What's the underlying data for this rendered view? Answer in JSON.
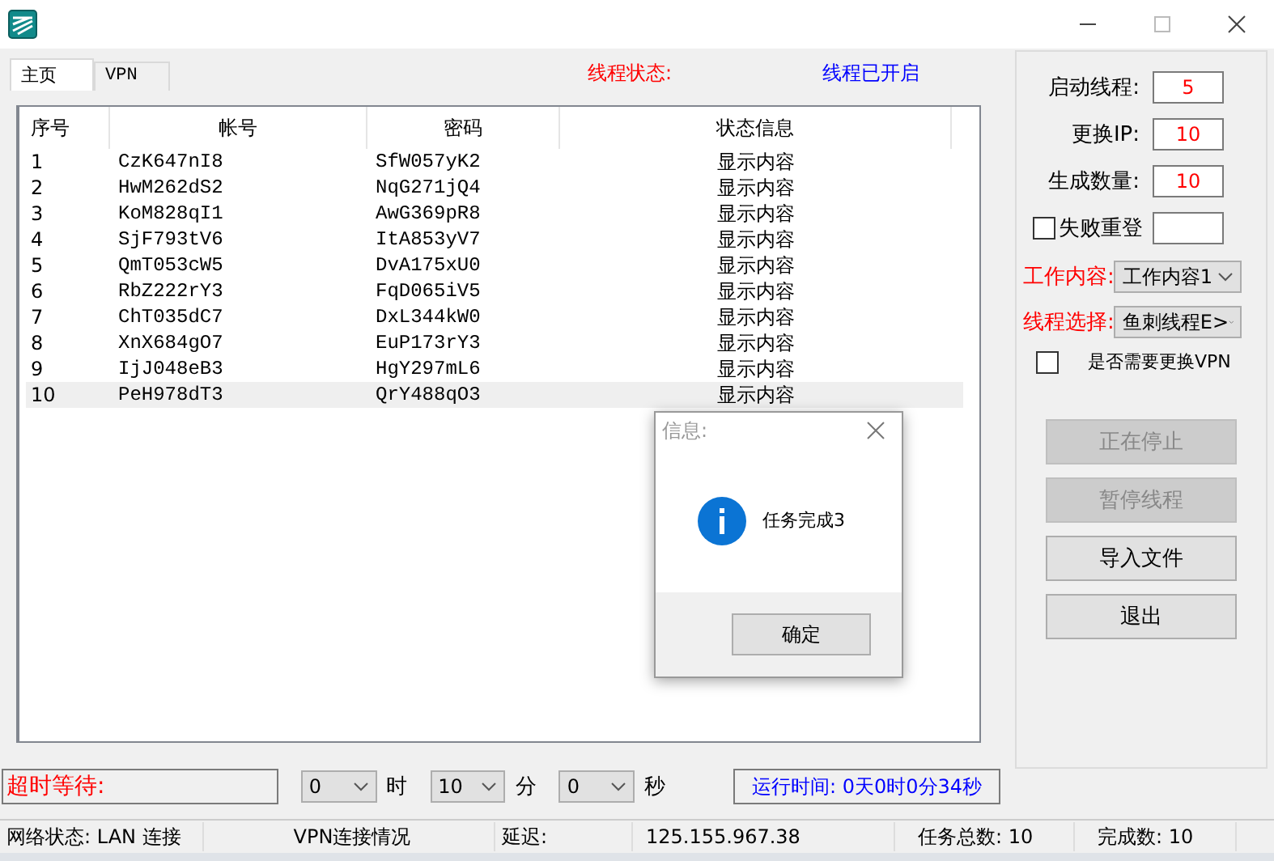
{
  "tabs": [
    {
      "label": "主页",
      "selected": true
    },
    {
      "label": "VPN",
      "selected": false
    }
  ],
  "thread_status": {
    "label": "线程状态:",
    "value": "线程已开启"
  },
  "table": {
    "columns": [
      "序号",
      "帐号",
      "密码",
      "状态信息"
    ],
    "rows": [
      {
        "cells": [
          "1",
          "CzK647nI8",
          "SfW057yK2",
          "显示内容"
        ],
        "selected": false
      },
      {
        "cells": [
          "2",
          "HwM262dS2",
          "NqG271jQ4",
          "显示内容"
        ],
        "selected": false
      },
      {
        "cells": [
          "3",
          "KoM828qI1",
          "AwG369pR8",
          "显示内容"
        ],
        "selected": false
      },
      {
        "cells": [
          "4",
          "SjF793tV6",
          "ItA853yV7",
          "显示内容"
        ],
        "selected": false
      },
      {
        "cells": [
          "5",
          "QmT053cW5",
          "DvA175xU0",
          "显示内容"
        ],
        "selected": false
      },
      {
        "cells": [
          "6",
          "RbZ222rY3",
          "FqD065iV5",
          "显示内容"
        ],
        "selected": false
      },
      {
        "cells": [
          "7",
          "ChT035dC7",
          "DxL344kW0",
          "显示内容"
        ],
        "selected": false
      },
      {
        "cells": [
          "8",
          "XnX684gO7",
          "EuP173rY3",
          "显示内容"
        ],
        "selected": false
      },
      {
        "cells": [
          "9",
          "IjJ048eB3",
          "HgY297mL6",
          "显示内容"
        ],
        "selected": false
      },
      {
        "cells": [
          "10",
          "PeH978dT3",
          "QrY488qO3",
          "显示内容"
        ],
        "selected": true
      }
    ]
  },
  "settings": {
    "fields": [
      {
        "label": "启动线程:",
        "value": "5"
      },
      {
        "label": "更换IP:",
        "value": "10"
      },
      {
        "label": "生成数量:",
        "value": "10"
      }
    ],
    "retry": {
      "label": "失败重登",
      "checked": false
    },
    "selects": [
      {
        "label": "工作内容:",
        "value": "工作内容1"
      },
      {
        "label": "线程选择:",
        "value": "鱼刺线程E>"
      }
    ],
    "vpn_switch": {
      "label": "是否需要更换VPN",
      "checked": false
    },
    "buttons": [
      {
        "label": "正在停止",
        "disabled": true
      },
      {
        "label": "暂停线程",
        "disabled": true
      },
      {
        "label": "导入文件",
        "disabled": false
      },
      {
        "label": "退出",
        "disabled": false
      }
    ]
  },
  "timeout": {
    "label": "超时等待:",
    "parts": [
      {
        "value": "0",
        "unit": "时"
      },
      {
        "value": "10",
        "unit": "分"
      },
      {
        "value": "0",
        "unit": "秒"
      }
    ]
  },
  "run_time": "运行时间: 0天0时0分34秒",
  "status_bar": [
    "网络状态: LAN 连接",
    "VPN连接情况",
    "延迟:",
    "125.155.967.38",
    "任务总数: 10",
    "完成数: 10"
  ],
  "dialog": {
    "title": "信息:",
    "message": "任务完成3",
    "button": "确定"
  }
}
